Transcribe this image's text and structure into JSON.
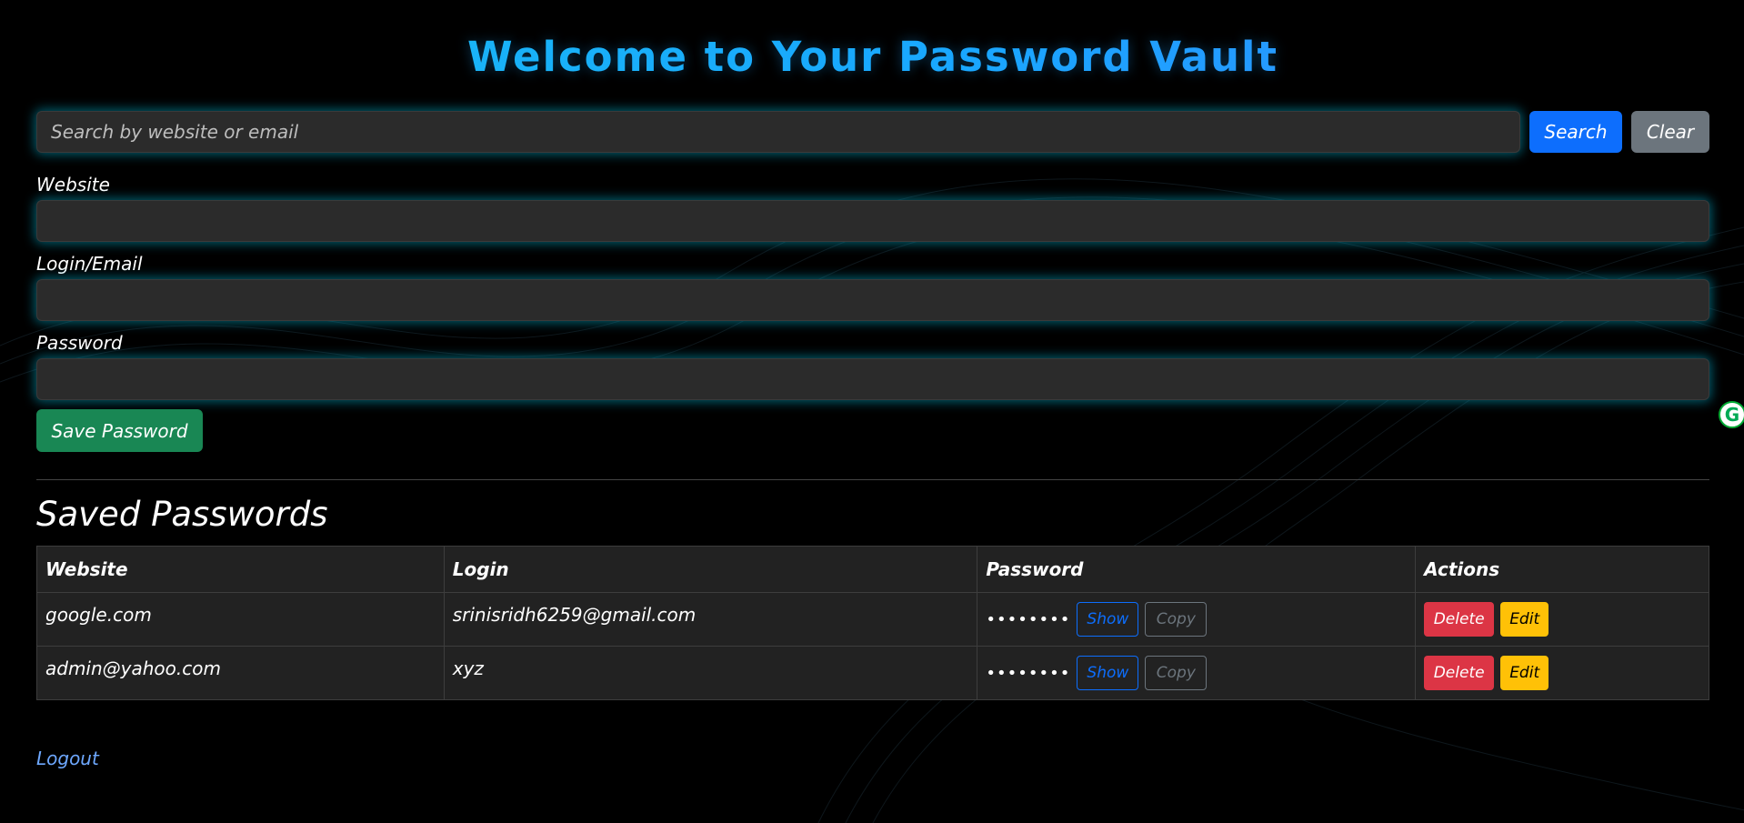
{
  "header": {
    "title": "Welcome to Your Password Vault"
  },
  "search": {
    "placeholder": "Search by website or email",
    "value": "",
    "search_label": "Search",
    "clear_label": "Clear"
  },
  "form": {
    "website_label": "Website",
    "website_value": "",
    "login_label": "Login/Email",
    "login_value": "",
    "password_label": "Password",
    "password_value": "",
    "save_label": "Save Password"
  },
  "saved": {
    "title": "Saved Passwords",
    "columns": [
      "Website",
      "Login",
      "Password",
      "Actions"
    ],
    "rows": [
      {
        "website": "google.com",
        "login": "srinisridh6259@gmail.com",
        "password_masked": "••••••••",
        "show_label": "Show",
        "copy_label": "Copy",
        "delete_label": "Delete",
        "edit_label": "Edit"
      },
      {
        "website": "admin@yahoo.com",
        "login": "xyz",
        "password_masked": "••••••••",
        "show_label": "Show",
        "copy_label": "Copy",
        "delete_label": "Delete",
        "edit_label": "Edit"
      }
    ]
  },
  "footer": {
    "logout_label": "Logout"
  },
  "colors": {
    "primary": "#0d6efd",
    "secondary": "#6c757d",
    "success": "#198754",
    "danger": "#dc3545",
    "warning": "#ffc107",
    "glow": "#00aac8"
  },
  "icons": {
    "extension": "grammarly-icon"
  }
}
